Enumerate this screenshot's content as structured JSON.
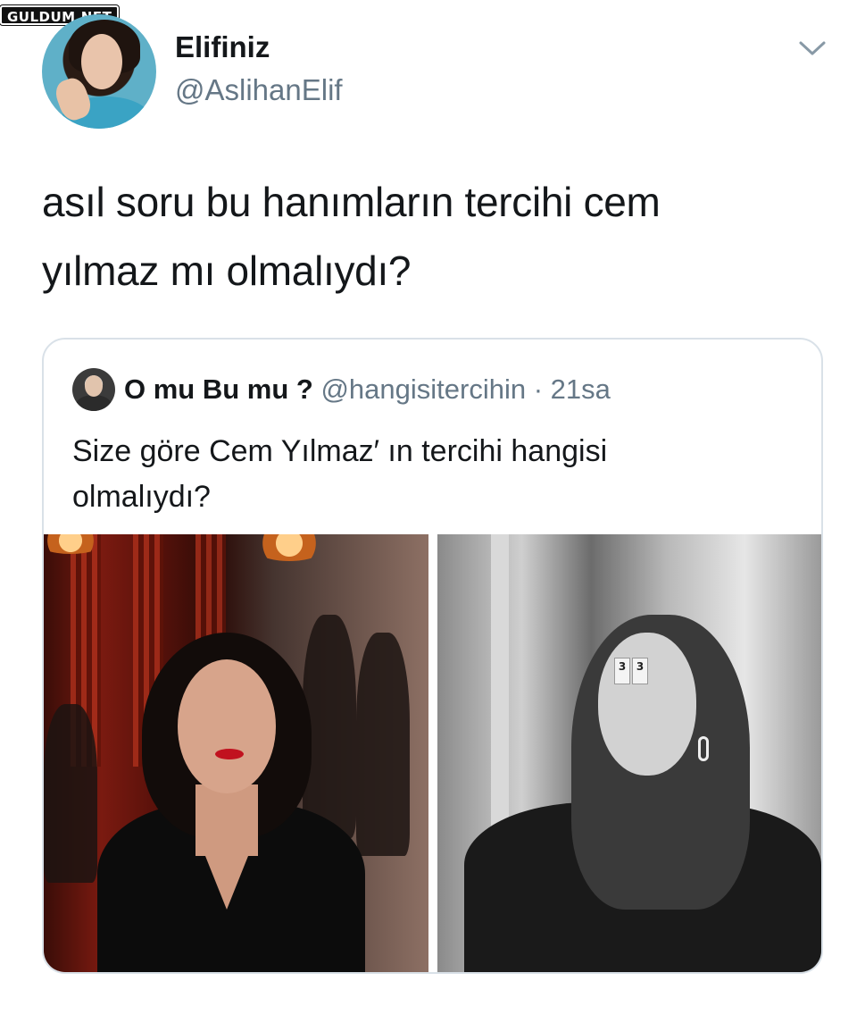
{
  "watermark": "GULDUM.NET",
  "tweet": {
    "display_name": "Elifiniz",
    "handle": "@AslihanElif",
    "text_line1": "asıl soru bu hanımların tercihi cem",
    "text_line2": "yılmaz mı olmalıydı?",
    "menu_icon": "chevron-down-icon"
  },
  "quoted": {
    "display_name": "O mu Bu mu ?",
    "handle": "@hangisitercihin",
    "separator": "·",
    "time": "21sa",
    "text_line1": "Size göre Cem Yılmaz′ ın tercihi hangisi",
    "text_line2": "olmalıydı?",
    "tile_left": "3",
    "tile_right": "3"
  },
  "colors": {
    "text": "#14171a",
    "secondary": "#657786",
    "border": "#d9e1e8",
    "background": "#ffffff"
  }
}
